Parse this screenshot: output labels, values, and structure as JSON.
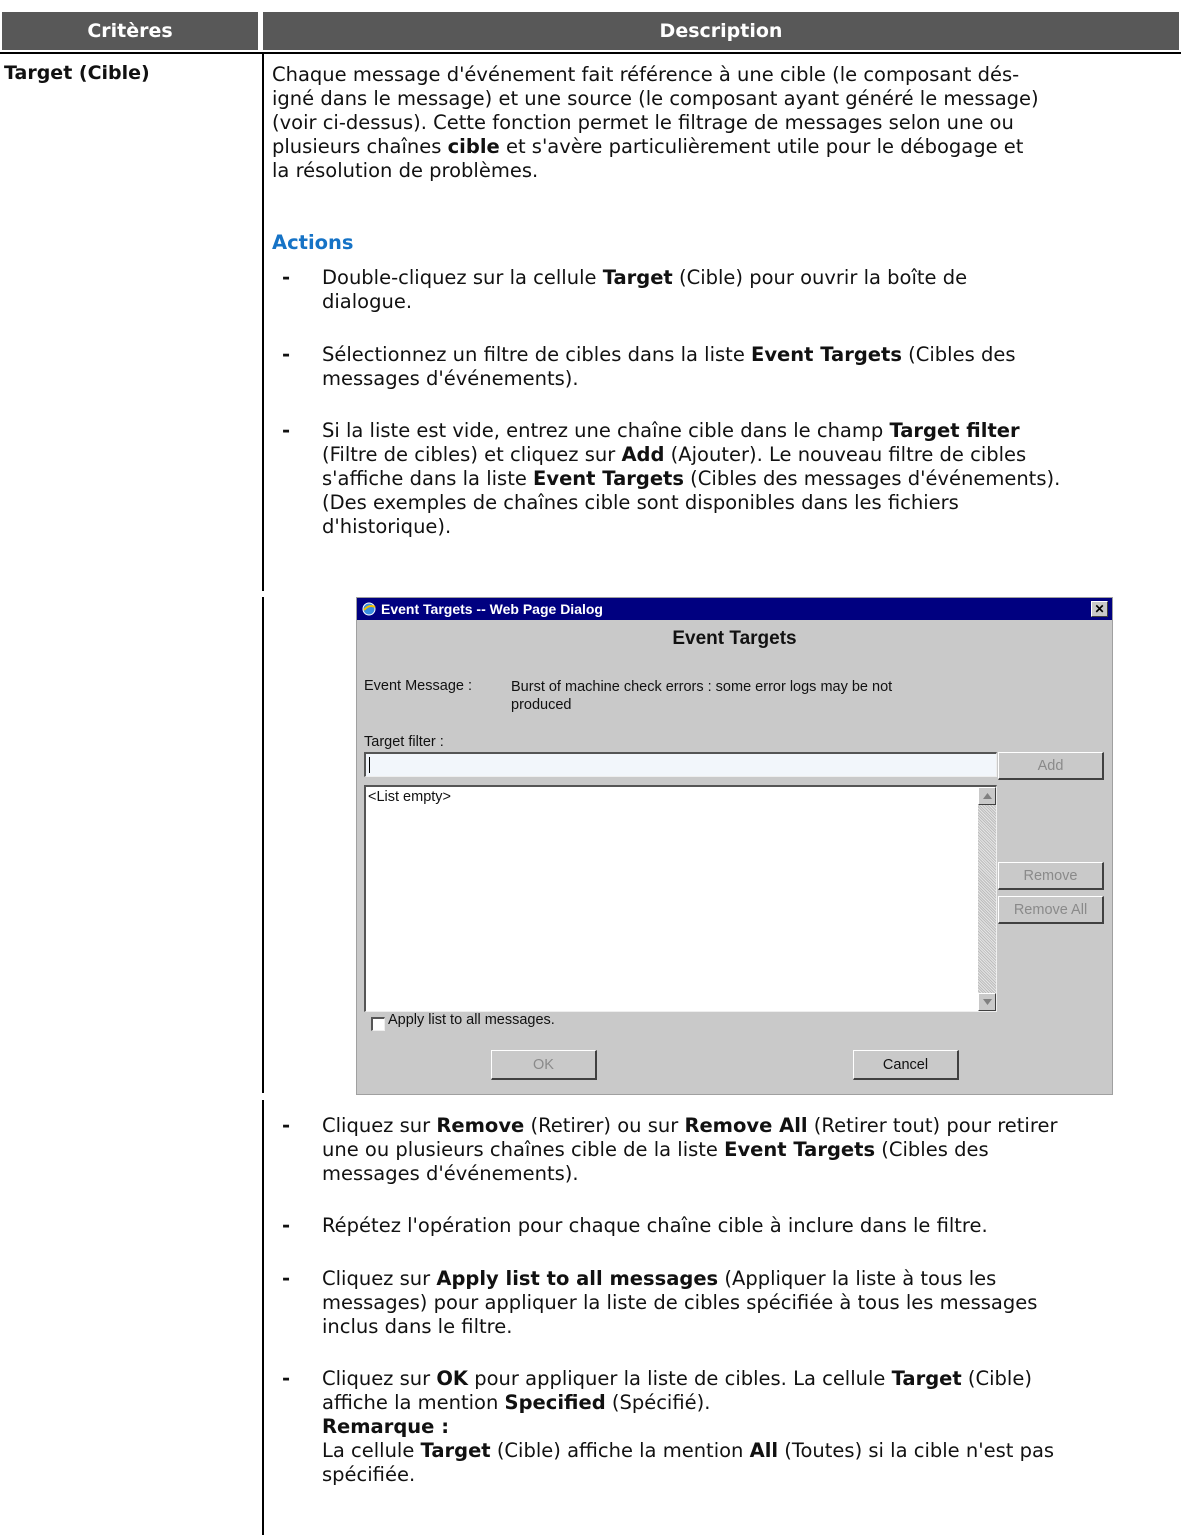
{
  "table": {
    "headers": [
      "Critères",
      "Description"
    ],
    "row_label": "Target (Cible)"
  },
  "intro": {
    "p1": "Chaque message d'événement fait référence à une cible (le composant dés-",
    "p2": "igné dans le message) et une source (le composant ayant généré le message)",
    "p3": "(voir ci-dessus). Cette fonction permet le filtrage de messages selon une ou",
    "p4_pre": "plusieurs chaînes ",
    "p4_bold": "cible",
    "p4_post": " et s'avère particulièrement utile pour le débogage et",
    "p5": "la résolution de problèmes."
  },
  "actions_title": "Actions",
  "bullets": {
    "b1": {
      "t1": "Double-cliquez sur la cellule ",
      "b1": "Target",
      "t2": " (Cible) pour ouvrir la boîte de",
      "t3": "dialogue."
    },
    "b2": {
      "t1": "Sélectionnez un filtre de cibles dans la liste ",
      "b1": "Event Targets",
      "t2": " (Cibles des",
      "t3": "messages d'événements)."
    },
    "b3": {
      "t1": "Si la liste est vide, entrez une chaîne cible dans le champ ",
      "b1": "Target filter",
      "t2": "(Filtre de cibles) et cliquez sur ",
      "b2": "Add",
      "t3": " (Ajouter). Le nouveau filtre de cibles",
      "t4": "s'affiche dans la liste ",
      "b3": "Event Targets",
      "t5": " (Cibles des messages d'événements).",
      "t6": "(Des exemples de chaînes cible sont disponibles dans les fichiers",
      "t7": "d'historique)."
    },
    "b4": {
      "t1": "Cliquez sur ",
      "b1": "Remove",
      "t2": " (Retirer) ou sur ",
      "b2": "Remove All",
      "t3": " (Retirer tout) pour retirer",
      "t4": "une ou plusieurs chaînes cible de la liste ",
      "b3": "Event Targets",
      "t5": " (Cibles des",
      "t6": "messages d'événements)."
    },
    "b5": {
      "t1": "Répétez l'opération pour chaque chaîne cible à inclure dans le filtre."
    },
    "b6": {
      "t1": "Cliquez sur ",
      "b1": "Apply list to all messages",
      "t2": " (Appliquer la liste à tous les",
      "t3": "messages) pour appliquer la liste de cibles spécifiée à tous les messages",
      "t4": "inclus dans le filtre."
    },
    "b7": {
      "t1": "Cliquez sur ",
      "b1": "OK",
      "t2": " pour appliquer la liste de cibles. La cellule ",
      "b2": "Target",
      "t3": " (Cible)",
      "t4": "affiche la mention ",
      "b3": "Specified",
      "t5": " (Spécifié).",
      "b4": "Remarque :",
      "t6": "La cellule ",
      "b5": "Target",
      "t7": " (Cible) affiche la mention ",
      "b6": "All",
      "t8": " (Toutes) si la cible n'est pas",
      "t9": "spécifiée."
    }
  },
  "dialog": {
    "window_title": "Event Targets -- Web Page Dialog",
    "heading": "Event Targets",
    "event_message_label": "Event Message :",
    "event_message_line1": "Burst of machine check errors : some error logs may be not",
    "event_message_line2": "produced",
    "target_filter_label": "Target filter :",
    "target_filter_value": "",
    "add_label": "Add",
    "list_empty": "<List empty>",
    "remove_label": "Remove",
    "remove_all_label": "Remove All",
    "apply_label": "Apply list to all messages.",
    "apply_checked": false,
    "ok_label": "OK",
    "cancel_label": "Cancel",
    "close_glyph": "✕",
    "colors": {
      "titlebar": "#000080",
      "face": "#c9c9c9"
    }
  },
  "colors": {
    "header_bg": "#585858",
    "actions": "#1673c6"
  }
}
